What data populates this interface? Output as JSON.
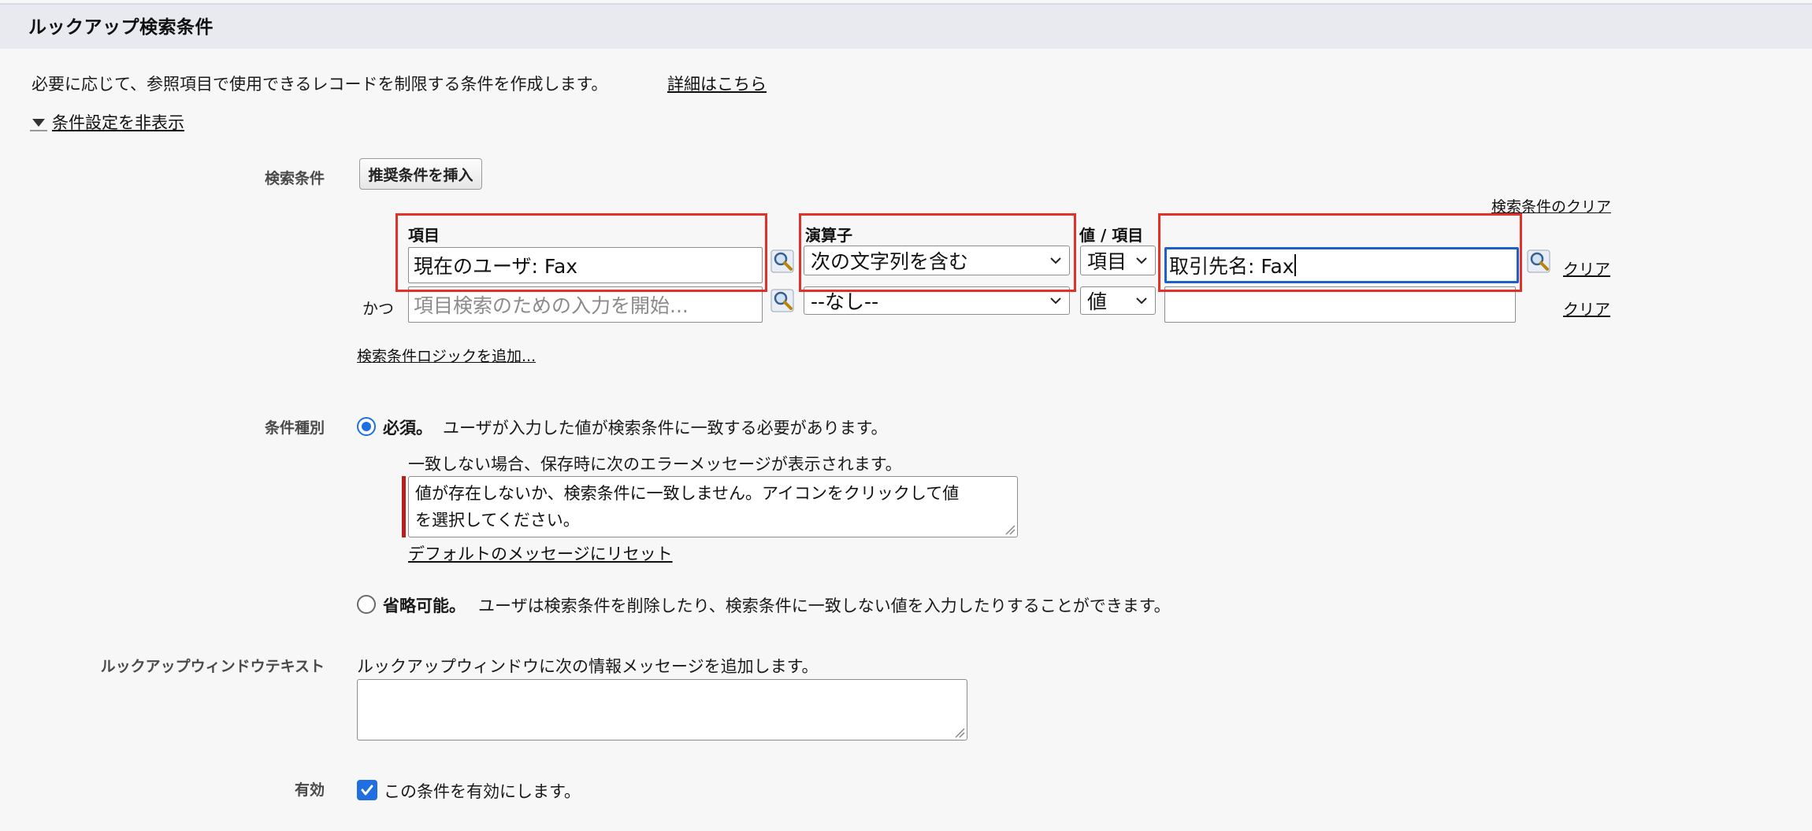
{
  "header": {
    "title": "ルックアップ検索条件"
  },
  "intro": {
    "text": "必要に応じて、参照項目で使用できるレコードを制限する条件を作成します。",
    "details_link": "詳細はこちら",
    "toggle_label": "条件設定を非表示"
  },
  "filter": {
    "label": "検索条件",
    "insert_button": "推奨条件を挿入",
    "clear_filters_link": "検索条件のクリア",
    "columns": {
      "field": "項目",
      "operator": "演算子",
      "value": "値 / 項目"
    },
    "rows": [
      {
        "connector": "",
        "field_value": "現在のユーザ: Fax",
        "operator": "次の文字列を含む",
        "value_type": "項目",
        "value": "取引先名: Fax",
        "clear": "クリア"
      },
      {
        "connector": "かつ",
        "field_placeholder": "項目検索のための入力を開始...",
        "operator": "--なし--",
        "value_type": "値",
        "value": "",
        "clear": "クリア"
      }
    ],
    "add_logic_link": "検索条件ロジックを追加..."
  },
  "filter_type": {
    "label": "条件種別",
    "required": {
      "title": "必須。",
      "desc": "ユーザが入力した値が検索条件に一致する必要があります。",
      "error_intro": "一致しない場合、保存時に次のエラーメッセージが表示されます。",
      "error_line1": "値が存在しないか、検索条件に一致しません。アイコンをクリックして値",
      "error_line2": "を選択してください。",
      "reset_link": "デフォルトのメッセージにリセット",
      "selected": true
    },
    "optional": {
      "title": "省略可能。",
      "desc": "ユーザは検索条件を削除したり、検索条件に一致しない値を入力したりすることができます。",
      "selected": false
    }
  },
  "lookup_window": {
    "label": "ルックアップウィンドウテキスト",
    "desc": "ルックアップウィンドウに次の情報メッセージを追加します。",
    "text": ""
  },
  "active": {
    "label": "有効",
    "checkbox_label": "この条件を有効にします。",
    "checked": true
  },
  "colors": {
    "highlight": "#e0322a",
    "focus": "#1f5fc9",
    "accent": "#1f6fe0",
    "error": "#b8201a"
  }
}
